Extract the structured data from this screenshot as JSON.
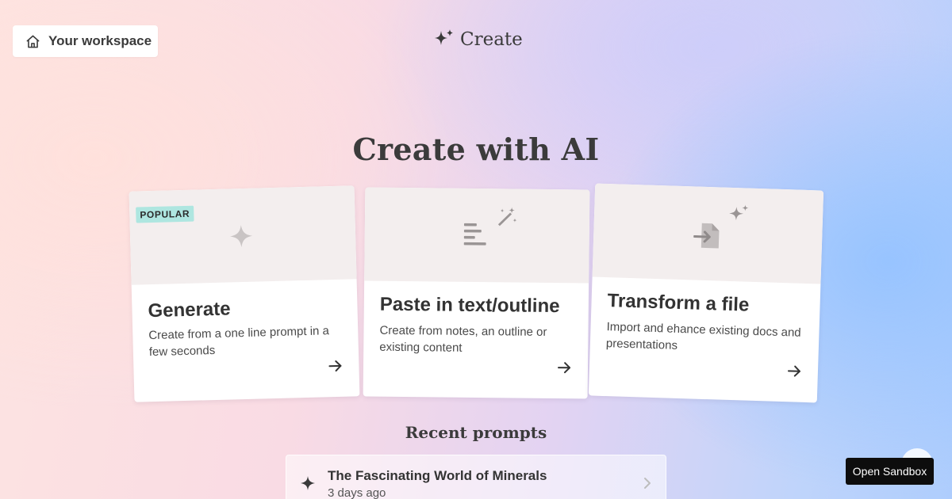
{
  "header": {
    "workspace_label": "Your workspace",
    "brand_label": "Create"
  },
  "hero": {
    "title": "Create with AI"
  },
  "cards": [
    {
      "badge": "POPULAR",
      "title": "Generate",
      "description": "Create from a one line prompt in a few seconds",
      "icon": "sparkle-icon"
    },
    {
      "title": "Paste in text/outline",
      "description": "Create from notes, an outline or existing content",
      "icon": "text-wand-icon"
    },
    {
      "title": "Transform a file",
      "description": "Import and ehance existing docs and presentations",
      "icon": "file-import-icon"
    }
  ],
  "recent": {
    "title": "Recent prompts",
    "items": [
      {
        "title": "The Fascinating World of Minerals",
        "time": "3 days ago"
      }
    ]
  },
  "sandbox": {
    "label": "Open Sandbox"
  },
  "colors": {
    "badge_bg": "#aee6e0",
    "card_thumb_bg": "#f3eeee",
    "sandbox_bg": "#0d0d0d"
  }
}
